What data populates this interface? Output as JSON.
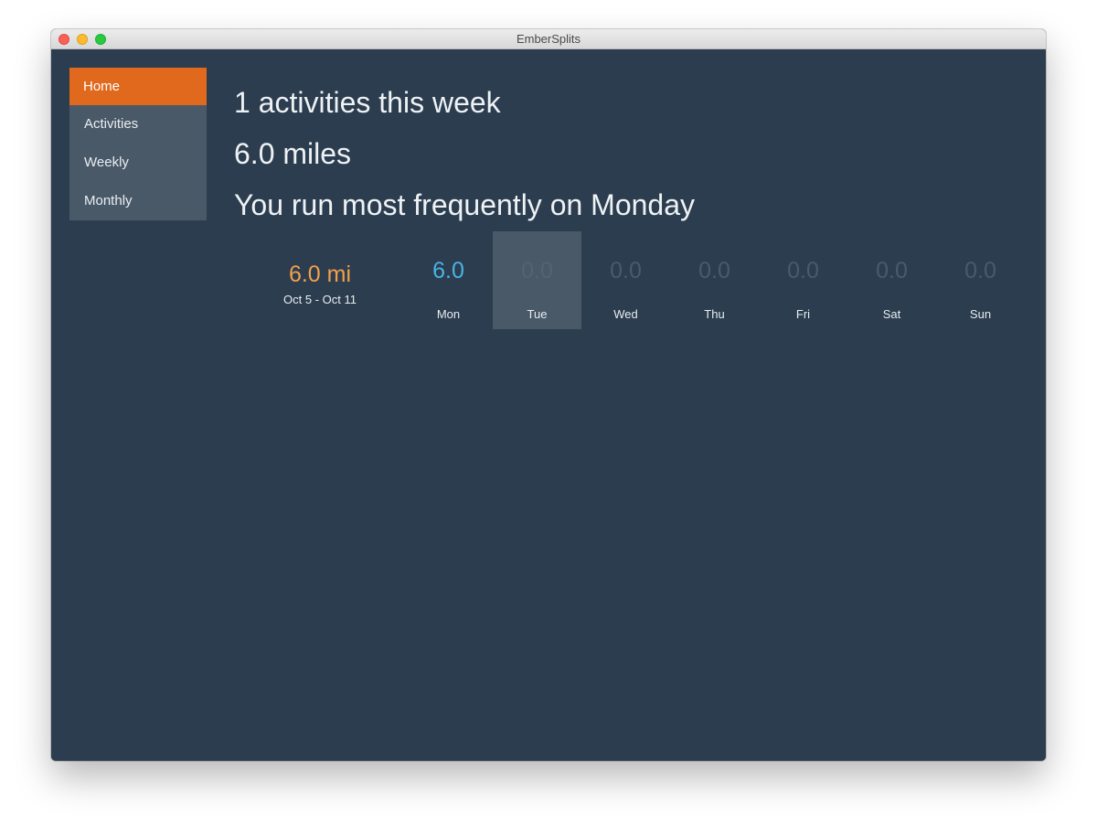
{
  "window": {
    "title": "EmberSplits"
  },
  "sidebar": {
    "items": [
      {
        "label": "Home",
        "active": true
      },
      {
        "label": "Activities",
        "active": false
      },
      {
        "label": "Weekly",
        "active": false
      },
      {
        "label": "Monthly",
        "active": false
      }
    ]
  },
  "summary": {
    "activities_line": "1 activities this week",
    "distance_line": "6.0 miles",
    "frequency_line": "You run most frequently on Monday"
  },
  "week": {
    "total": "6.0 mi",
    "range": "Oct 5 - Oct 11",
    "days": [
      {
        "label": "Mon",
        "value": "6.0"
      },
      {
        "label": "Tue",
        "value": "0.0"
      },
      {
        "label": "Wed",
        "value": "0.0"
      },
      {
        "label": "Thu",
        "value": "0.0"
      },
      {
        "label": "Fri",
        "value": "0.0"
      },
      {
        "label": "Sat",
        "value": "0.0"
      },
      {
        "label": "Sun",
        "value": "0.0"
      }
    ]
  },
  "colors": {
    "background": "#2c3d4f",
    "sidebar": "#4a5968",
    "accent": "#e0691d",
    "total": "#f2a04a",
    "active_day_value": "#49b3e4",
    "inactive_day_value": "#4a5a6a"
  }
}
